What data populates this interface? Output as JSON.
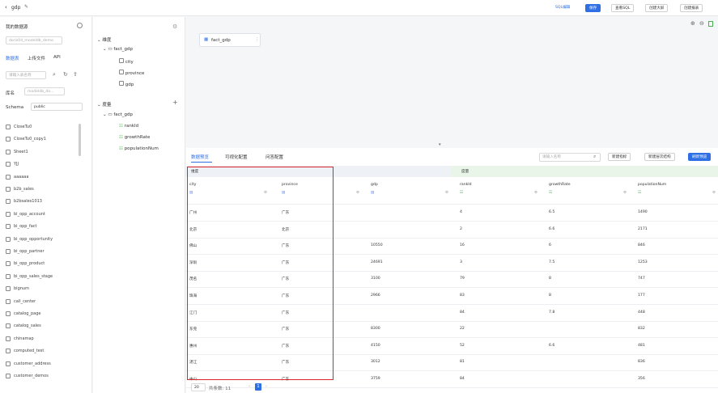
{
  "topbar": {
    "back_title": "gdp",
    "buttons": {
      "sql_mode": "SQL编辑",
      "save": "保存",
      "view_sql": "查看SQL",
      "create_screen": "创建大屏",
      "create_report": "创建报表"
    }
  },
  "left_panel": {
    "title": "我的数据源",
    "datasource": "doris04_modeldb_demo",
    "tabs": [
      "数据表",
      "上传文件",
      "API"
    ],
    "search_placeholder": "请输入表名称",
    "library_label": "库名",
    "library_value": "modeldb_do...",
    "schema_label": "Schema",
    "schema_value": "public",
    "tables": [
      "CloseTu0",
      "CloseTu0_copy1",
      "Sheet1",
      "YJJ",
      "aaaaaa",
      "b2b_sales",
      "b2bsales1013",
      "bi_opp_account",
      "bi_opp_fact",
      "bi_opp_opportunity",
      "bi_opp_partner",
      "bi_opp_product",
      "bi_opp_sales_stage",
      "bignum",
      "call_center",
      "catalog_page",
      "catalog_sales",
      "chinamap",
      "computed_test",
      "customer_address",
      "customer_demos"
    ]
  },
  "field_tree": {
    "dimension": "维度",
    "measure": "度量",
    "dim_table": "fact_gdp",
    "dim_fields": [
      "city",
      "province",
      "gdp"
    ],
    "mea_table": "fact_gdp",
    "mea_fields": [
      "rankId",
      "growthRate",
      "populationNum"
    ]
  },
  "canvas": {
    "node_label": "fact_gdp"
  },
  "tabs": {
    "items": [
      "数据预览",
      "可视化配置",
      "问答配置"
    ],
    "search_placeholder": "请输入名称",
    "btn_add_metric": "新建指标",
    "btn_add_level": "新建层次结构",
    "btn_refresh": "刷新预览"
  },
  "table": {
    "group_dim": "维度",
    "group_mea": "度量",
    "columns": [
      "city",
      "province",
      "gdp",
      "rankId",
      "growthRate",
      "populationNum"
    ],
    "rows": [
      [
        "广州",
        "广东",
        "",
        "4",
        "6.5",
        "1490"
      ],
      [
        "北京",
        "北京",
        "",
        "2",
        "6.6",
        "2171"
      ],
      [
        "佛山",
        "广东",
        "10550",
        "16",
        "6",
        "846"
      ],
      [
        "深圳",
        "广东",
        "24691",
        "3",
        "7.5",
        "1253"
      ],
      [
        "茂名",
        "广东",
        "3100",
        "79",
        "8",
        "747"
      ],
      [
        "珠海",
        "广东",
        "2966",
        "83",
        "8",
        "177"
      ],
      [
        "江门",
        "广东",
        "",
        "84",
        "7.8",
        "448"
      ],
      [
        "东莞",
        "广东",
        "8300",
        "22",
        "",
        "832"
      ],
      [
        "惠州",
        "广东",
        "4150",
        "52",
        "6.6",
        "481"
      ],
      [
        "湛江",
        "广东",
        "3012",
        "81",
        "",
        "836"
      ],
      [
        "中山",
        "广东",
        "3759",
        "84",
        "",
        "356"
      ]
    ]
  },
  "pagination": {
    "page_size": "20",
    "total": "共条数: 11",
    "page": "1"
  },
  "colors": {
    "accent": "#2f6fe4",
    "highlight": "#d9262b",
    "measure_green": "#e9f5e9"
  }
}
